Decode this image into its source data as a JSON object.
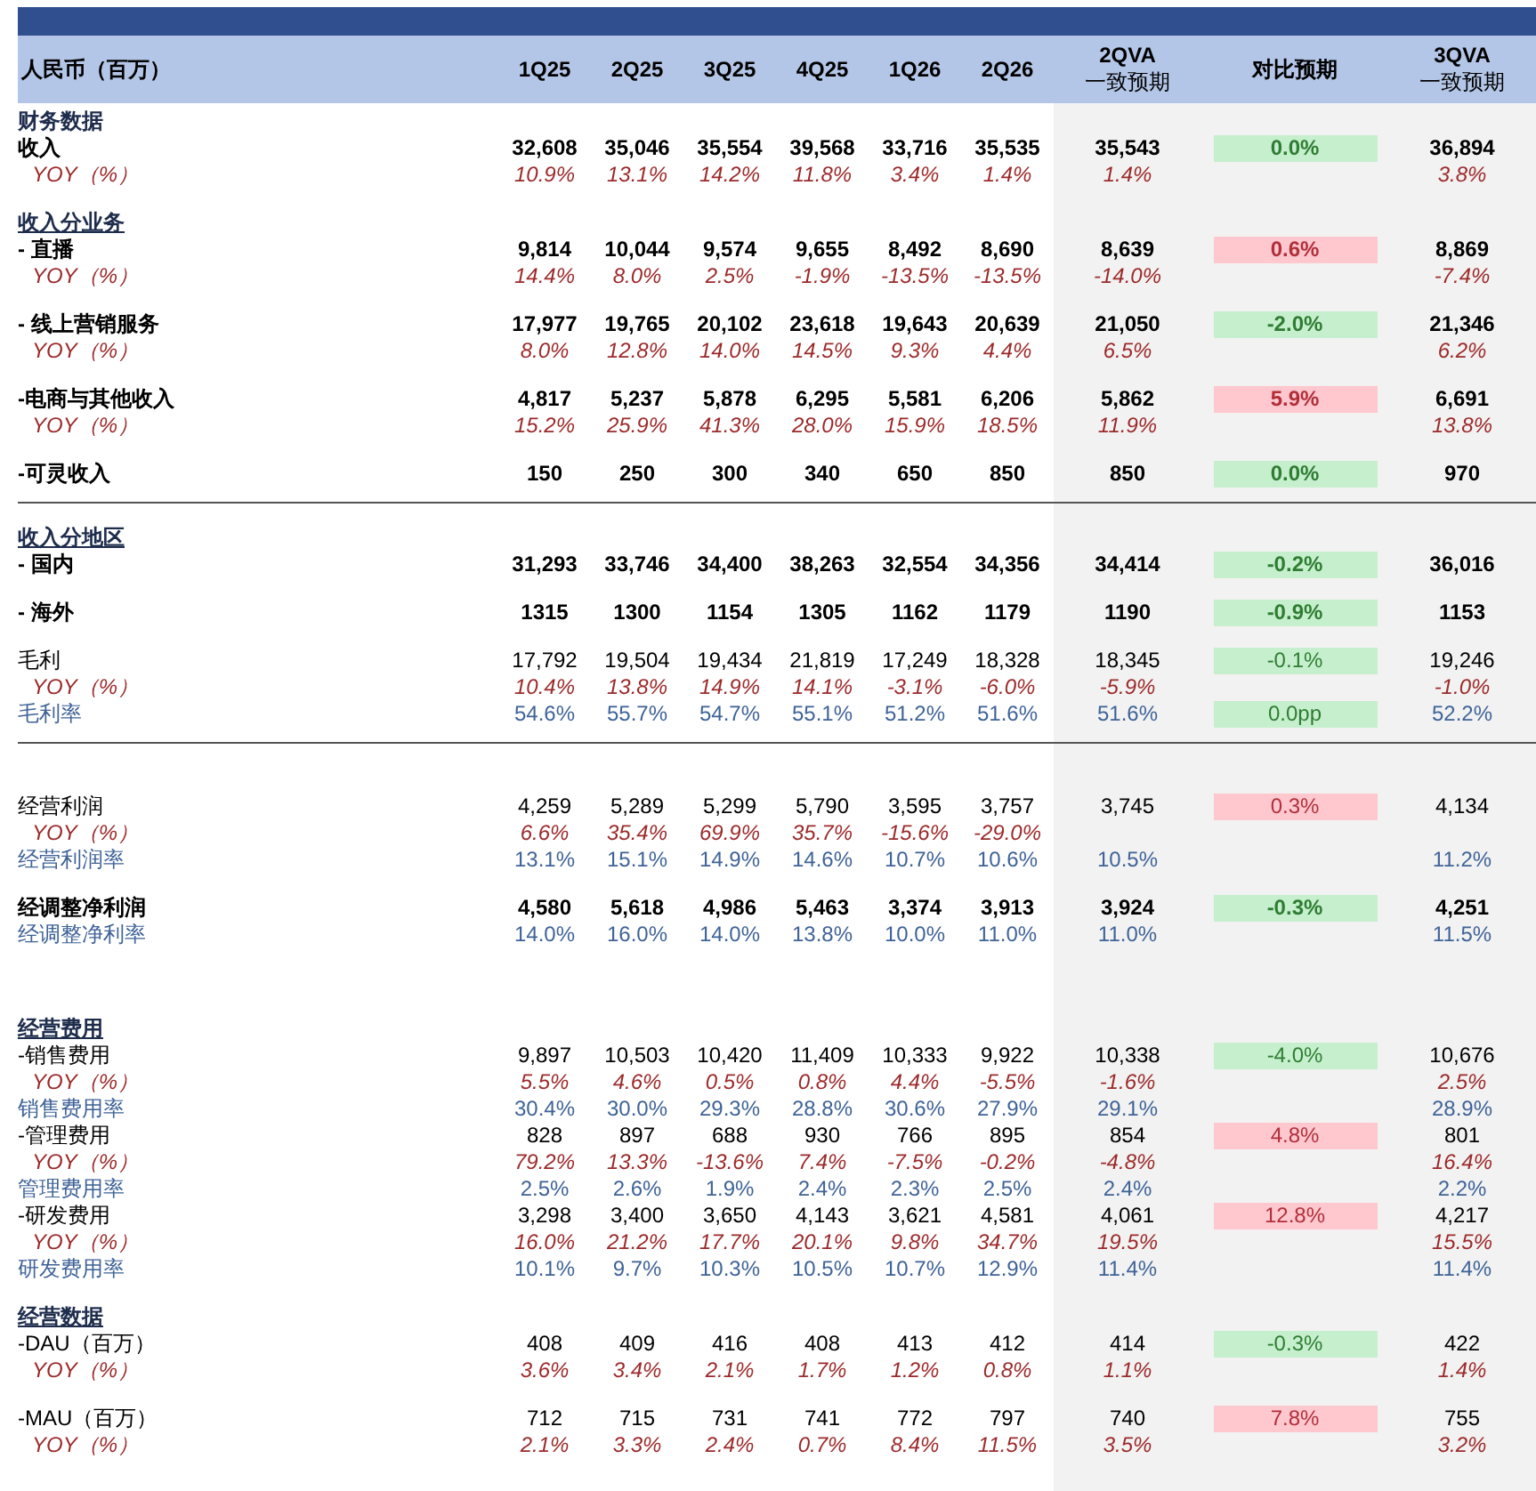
{
  "header": {
    "first": "人民币（百万）",
    "columns": [
      {
        "label": "1Q25"
      },
      {
        "label": "2Q25"
      },
      {
        "label": "3Q25"
      },
      {
        "label": "4Q25"
      },
      {
        "label": "1Q26"
      },
      {
        "label": "2Q26"
      },
      {
        "label": "2QVA",
        "sublabel": "一致预期"
      },
      {
        "label": "对比预期"
      },
      {
        "label": "3QVA",
        "sublabel": "一致预期"
      }
    ]
  },
  "blocks": [
    {
      "divider": false,
      "rows": [
        {
          "kind": "section",
          "label": "财务数据",
          "underlined": false
        },
        {
          "kind": "bold",
          "label": "收入",
          "values": [
            "32,608",
            "35,046",
            "35,554",
            "39,568",
            "33,716",
            "35,535"
          ],
          "q2": "35,543",
          "comparison": {
            "text": "0.0%",
            "color": "#c6efce"
          },
          "q3": "36,894"
        },
        {
          "kind": "yoy",
          "label": "YOY（%）",
          "values": [
            "10.9%",
            "13.1%",
            "14.2%",
            "11.8%",
            "3.4%",
            "1.4%"
          ],
          "q2": "1.4%",
          "q3": "3.8%"
        }
      ]
    },
    {
      "divider": false,
      "rows": [
        {
          "kind": "section",
          "label": "收入分业务",
          "underlined": true
        },
        {
          "kind": "bold",
          "label": "- 直播",
          "values": [
            "9,814",
            "10,044",
            "9,574",
            "9,655",
            "8,492",
            "8,690"
          ],
          "q2": "8,639",
          "comparison": {
            "text": "0.6%",
            "color": "#ffc7ce"
          },
          "q3": "8,869"
        },
        {
          "kind": "yoy",
          "label": "YOY（%）",
          "values": [
            "14.4%",
            "8.0%",
            "2.5%",
            "-1.9%",
            "-13.5%",
            "-13.5%"
          ],
          "q2": "-14.0%",
          "q3": "-7.4%"
        }
      ]
    },
    {
      "divider": false,
      "rows": [
        {
          "kind": "bold",
          "label": "- 线上营销服务",
          "values": [
            "17,977",
            "19,765",
            "20,102",
            "23,618",
            "19,643",
            "20,639"
          ],
          "q2": "21,050",
          "comparison": {
            "text": "-2.0%",
            "color": "#c6efce"
          },
          "q3": "21,346"
        },
        {
          "kind": "yoy",
          "label": "YOY（%）",
          "values": [
            "8.0%",
            "12.8%",
            "14.0%",
            "14.5%",
            "9.3%",
            "4.4%"
          ],
          "q2": "6.5%",
          "q3": "6.2%"
        }
      ]
    },
    {
      "divider": false,
      "rows": [
        {
          "kind": "bold",
          "label": "-电商与其他收入",
          "values": [
            "4,817",
            "5,237",
            "5,878",
            "6,295",
            "5,581",
            "6,206"
          ],
          "q2": "5,862",
          "comparison": {
            "text": "5.9%",
            "color": "#ffc7ce"
          },
          "q3": "6,691"
        },
        {
          "kind": "yoy",
          "label": "YOY（%）",
          "values": [
            "15.2%",
            "25.9%",
            "41.3%",
            "28.0%",
            "15.9%",
            "18.5%"
          ],
          "q2": "11.9%",
          "q3": "13.8%"
        }
      ]
    },
    {
      "divider": true,
      "rows": [
        {
          "kind": "bold",
          "label": "-可灵收入",
          "values": [
            "150",
            "250",
            "300",
            "340",
            "650",
            "850"
          ],
          "q2": "850",
          "comparison": {
            "text": "0.0%",
            "color": "#c6efce"
          },
          "q3": "970"
        }
      ]
    },
    {
      "divider": false,
      "rows": [
        {
          "kind": "section",
          "label": "收入分地区",
          "underlined": true
        },
        {
          "kind": "bold",
          "label": "- 国内",
          "values": [
            "31,293",
            "33,746",
            "34,400",
            "38,263",
            "32,554",
            "34,356"
          ],
          "q2": "34,414",
          "comparison": {
            "text": "-0.2%",
            "color": "#c6efce"
          },
          "q3": "36,016"
        }
      ]
    },
    {
      "divider": false,
      "rows": [
        {
          "kind": "bold",
          "label": "- 海外",
          "values": [
            "1315",
            "1300",
            "1154",
            "1305",
            "1162",
            "1179"
          ],
          "q2": "1190",
          "comparison": {
            "text": "-0.9%",
            "color": "#c6efce"
          },
          "q3": "1153"
        }
      ]
    },
    {
      "divider": true,
      "rows": [
        {
          "kind": "plain",
          "label": "毛利",
          "values": [
            "17,792",
            "19,504",
            "19,434",
            "21,819",
            "17,249",
            "18,328"
          ],
          "q2": "18,345",
          "comparison": {
            "text": "-0.1%",
            "color": "#c6efce"
          },
          "q3": "19,246"
        },
        {
          "kind": "yoy",
          "label": "YOY（%）",
          "values": [
            "10.4%",
            "13.8%",
            "14.9%",
            "14.1%",
            "-3.1%",
            "-6.0%"
          ],
          "q2": "-5.9%",
          "q3": "-1.0%"
        },
        {
          "kind": "ratio",
          "label": "毛利率",
          "values": [
            "54.6%",
            "55.7%",
            "54.7%",
            "55.1%",
            "51.2%",
            "51.6%"
          ],
          "q2": "51.6%",
          "comparison": {
            "text": "0.0pp",
            "color": "#c6efce"
          },
          "q3": "52.2%"
        }
      ]
    },
    {
      "divider": false,
      "rows": [
        {
          "kind": "plain",
          "label": "经营利润",
          "values": [
            "4,259",
            "5,289",
            "5,299",
            "5,790",
            "3,595",
            "3,757"
          ],
          "q2": "3,745",
          "comparison": {
            "text": "0.3%",
            "color": "#ffc7ce"
          },
          "q3": "4,134"
        },
        {
          "kind": "yoy",
          "label": "YOY（%）",
          "values": [
            "6.6%",
            "35.4%",
            "69.9%",
            "35.7%",
            "-15.6%",
            "-29.0%"
          ]
        },
        {
          "kind": "ratio",
          "label": "经营利润率",
          "values": [
            "13.1%",
            "15.1%",
            "14.9%",
            "14.6%",
            "10.7%",
            "10.6%"
          ],
          "q2": "10.5%",
          "q3": "11.2%"
        }
      ]
    },
    {
      "divider": false,
      "rows": [
        {
          "kind": "bold",
          "label": "经调整净利润",
          "values": [
            "4,580",
            "5,618",
            "4,986",
            "5,463",
            "3,374",
            "3,913"
          ],
          "q2": "3,924",
          "comparison": {
            "text": "-0.3%",
            "color": "#c6efce"
          },
          "q3": "4,251"
        },
        {
          "kind": "ratio",
          "label": "经调整净利率",
          "values": [
            "14.0%",
            "16.0%",
            "14.0%",
            "13.8%",
            "10.0%",
            "11.0%"
          ],
          "q2": "11.0%",
          "q3": "11.5%"
        }
      ]
    },
    {
      "divider": false,
      "rows": [
        {
          "kind": "section",
          "label": "经营费用",
          "underlined": true
        },
        {
          "kind": "plain",
          "label": "-销售费用",
          "values": [
            "9,897",
            "10,503",
            "10,420",
            "11,409",
            "10,333",
            "9,922"
          ],
          "q2": "10,338",
          "comparison": {
            "text": "-4.0%",
            "color": "#c6efce"
          },
          "q3": "10,676"
        },
        {
          "kind": "yoy",
          "label": "YOY（%）",
          "values": [
            "5.5%",
            "4.6%",
            "0.5%",
            "0.8%",
            "4.4%",
            "-5.5%"
          ],
          "q2": "-1.6%",
          "q3": "2.5%"
        },
        {
          "kind": "ratio",
          "label": "销售费用率",
          "values": [
            "30.4%",
            "30.0%",
            "29.3%",
            "28.8%",
            "30.6%",
            "27.9%"
          ],
          "q2": "29.1%",
          "q3": "28.9%"
        },
        {
          "kind": "plain",
          "label": "-管理费用",
          "values": [
            "828",
            "897",
            "688",
            "930",
            "766",
            "895"
          ],
          "q2": "854",
          "comparison": {
            "text": "4.8%",
            "color": "#ffc7ce"
          },
          "q3": "801"
        },
        {
          "kind": "yoy",
          "label": "YOY（%）",
          "values": [
            "79.2%",
            "13.3%",
            "-13.6%",
            "7.4%",
            "-7.5%",
            "-0.2%"
          ],
          "q2": "-4.8%",
          "q3": "16.4%"
        },
        {
          "kind": "ratio",
          "label": "管理费用率",
          "values": [
            "2.5%",
            "2.6%",
            "1.9%",
            "2.4%",
            "2.3%",
            "2.5%"
          ],
          "q2": "2.4%",
          "q3": "2.2%"
        },
        {
          "kind": "plain",
          "label": "-研发费用",
          "values": [
            "3,298",
            "3,400",
            "3,650",
            "4,143",
            "3,621",
            "4,581"
          ],
          "q2": "4,061",
          "comparison": {
            "text": "12.8%",
            "color": "#ffc7ce"
          },
          "q3": "4,217"
        },
        {
          "kind": "yoy",
          "label": "YOY（%）",
          "values": [
            "16.0%",
            "21.2%",
            "17.7%",
            "20.1%",
            "9.8%",
            "34.7%"
          ],
          "q2": "19.5%",
          "q3": "15.5%"
        },
        {
          "kind": "ratio",
          "label": "研发费用率",
          "values": [
            "10.1%",
            "9.7%",
            "10.3%",
            "10.5%",
            "10.7%",
            "12.9%"
          ],
          "q2": "11.4%",
          "q3": "11.4%"
        }
      ]
    },
    {
      "divider": false,
      "rows": [
        {
          "kind": "section",
          "label": "经营数据",
          "underlined": true
        },
        {
          "kind": "plain",
          "label": "-DAU（百万）",
          "values": [
            "408",
            "409",
            "416",
            "408",
            "413",
            "412"
          ],
          "q2": "414",
          "comparison": {
            "text": "-0.3%",
            "color": "#c6efce"
          },
          "q3": "422"
        },
        {
          "kind": "yoy",
          "label": "YOY（%）",
          "values": [
            "3.6%",
            "3.4%",
            "2.1%",
            "1.7%",
            "1.2%",
            "0.8%"
          ],
          "q2": "1.1%",
          "q3": "1.4%"
        }
      ]
    },
    {
      "divider": false,
      "rows": [
        {
          "kind": "plain",
          "label": "-MAU（百万）",
          "values": [
            "712",
            "715",
            "731",
            "741",
            "772",
            "797"
          ],
          "q2": "740",
          "comparison": {
            "text": "7.8%",
            "color": "#ffc7ce"
          },
          "q3": "755"
        },
        {
          "kind": "yoy",
          "label": "YOY（%）",
          "values": [
            "2.1%",
            "3.3%",
            "2.4%",
            "0.7%",
            "8.4%",
            "11.5%"
          ],
          "q2": "3.5%",
          "q3": "3.2%"
        }
      ]
    }
  ]
}
